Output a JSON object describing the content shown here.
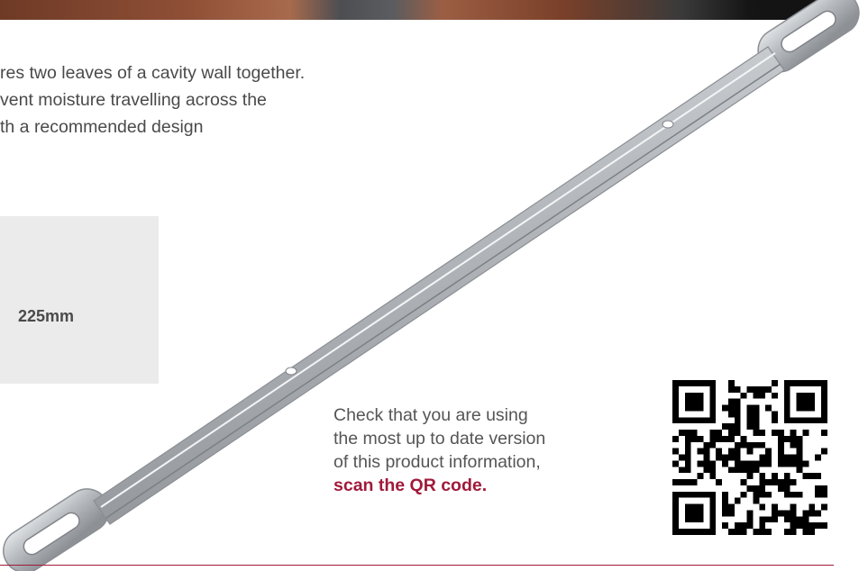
{
  "intro": {
    "lines": [
      "res two leaves of a cavity wall together.",
      "vent moisture travelling across the",
      "th a recommended design"
    ]
  },
  "spec": {
    "length_value": "225mm"
  },
  "qr_note": {
    "lines": [
      "Check that you are using",
      "the most up to date version",
      "of this product information,"
    ],
    "cta": "scan the QR code."
  },
  "colors": {
    "accent": "#a01a3a",
    "text": "#4a4a4a",
    "panel": "#ebebeb",
    "steel": "#b8bcc0"
  },
  "icons": {
    "qr": "qr-code-icon",
    "product": "wall-tie-image"
  }
}
